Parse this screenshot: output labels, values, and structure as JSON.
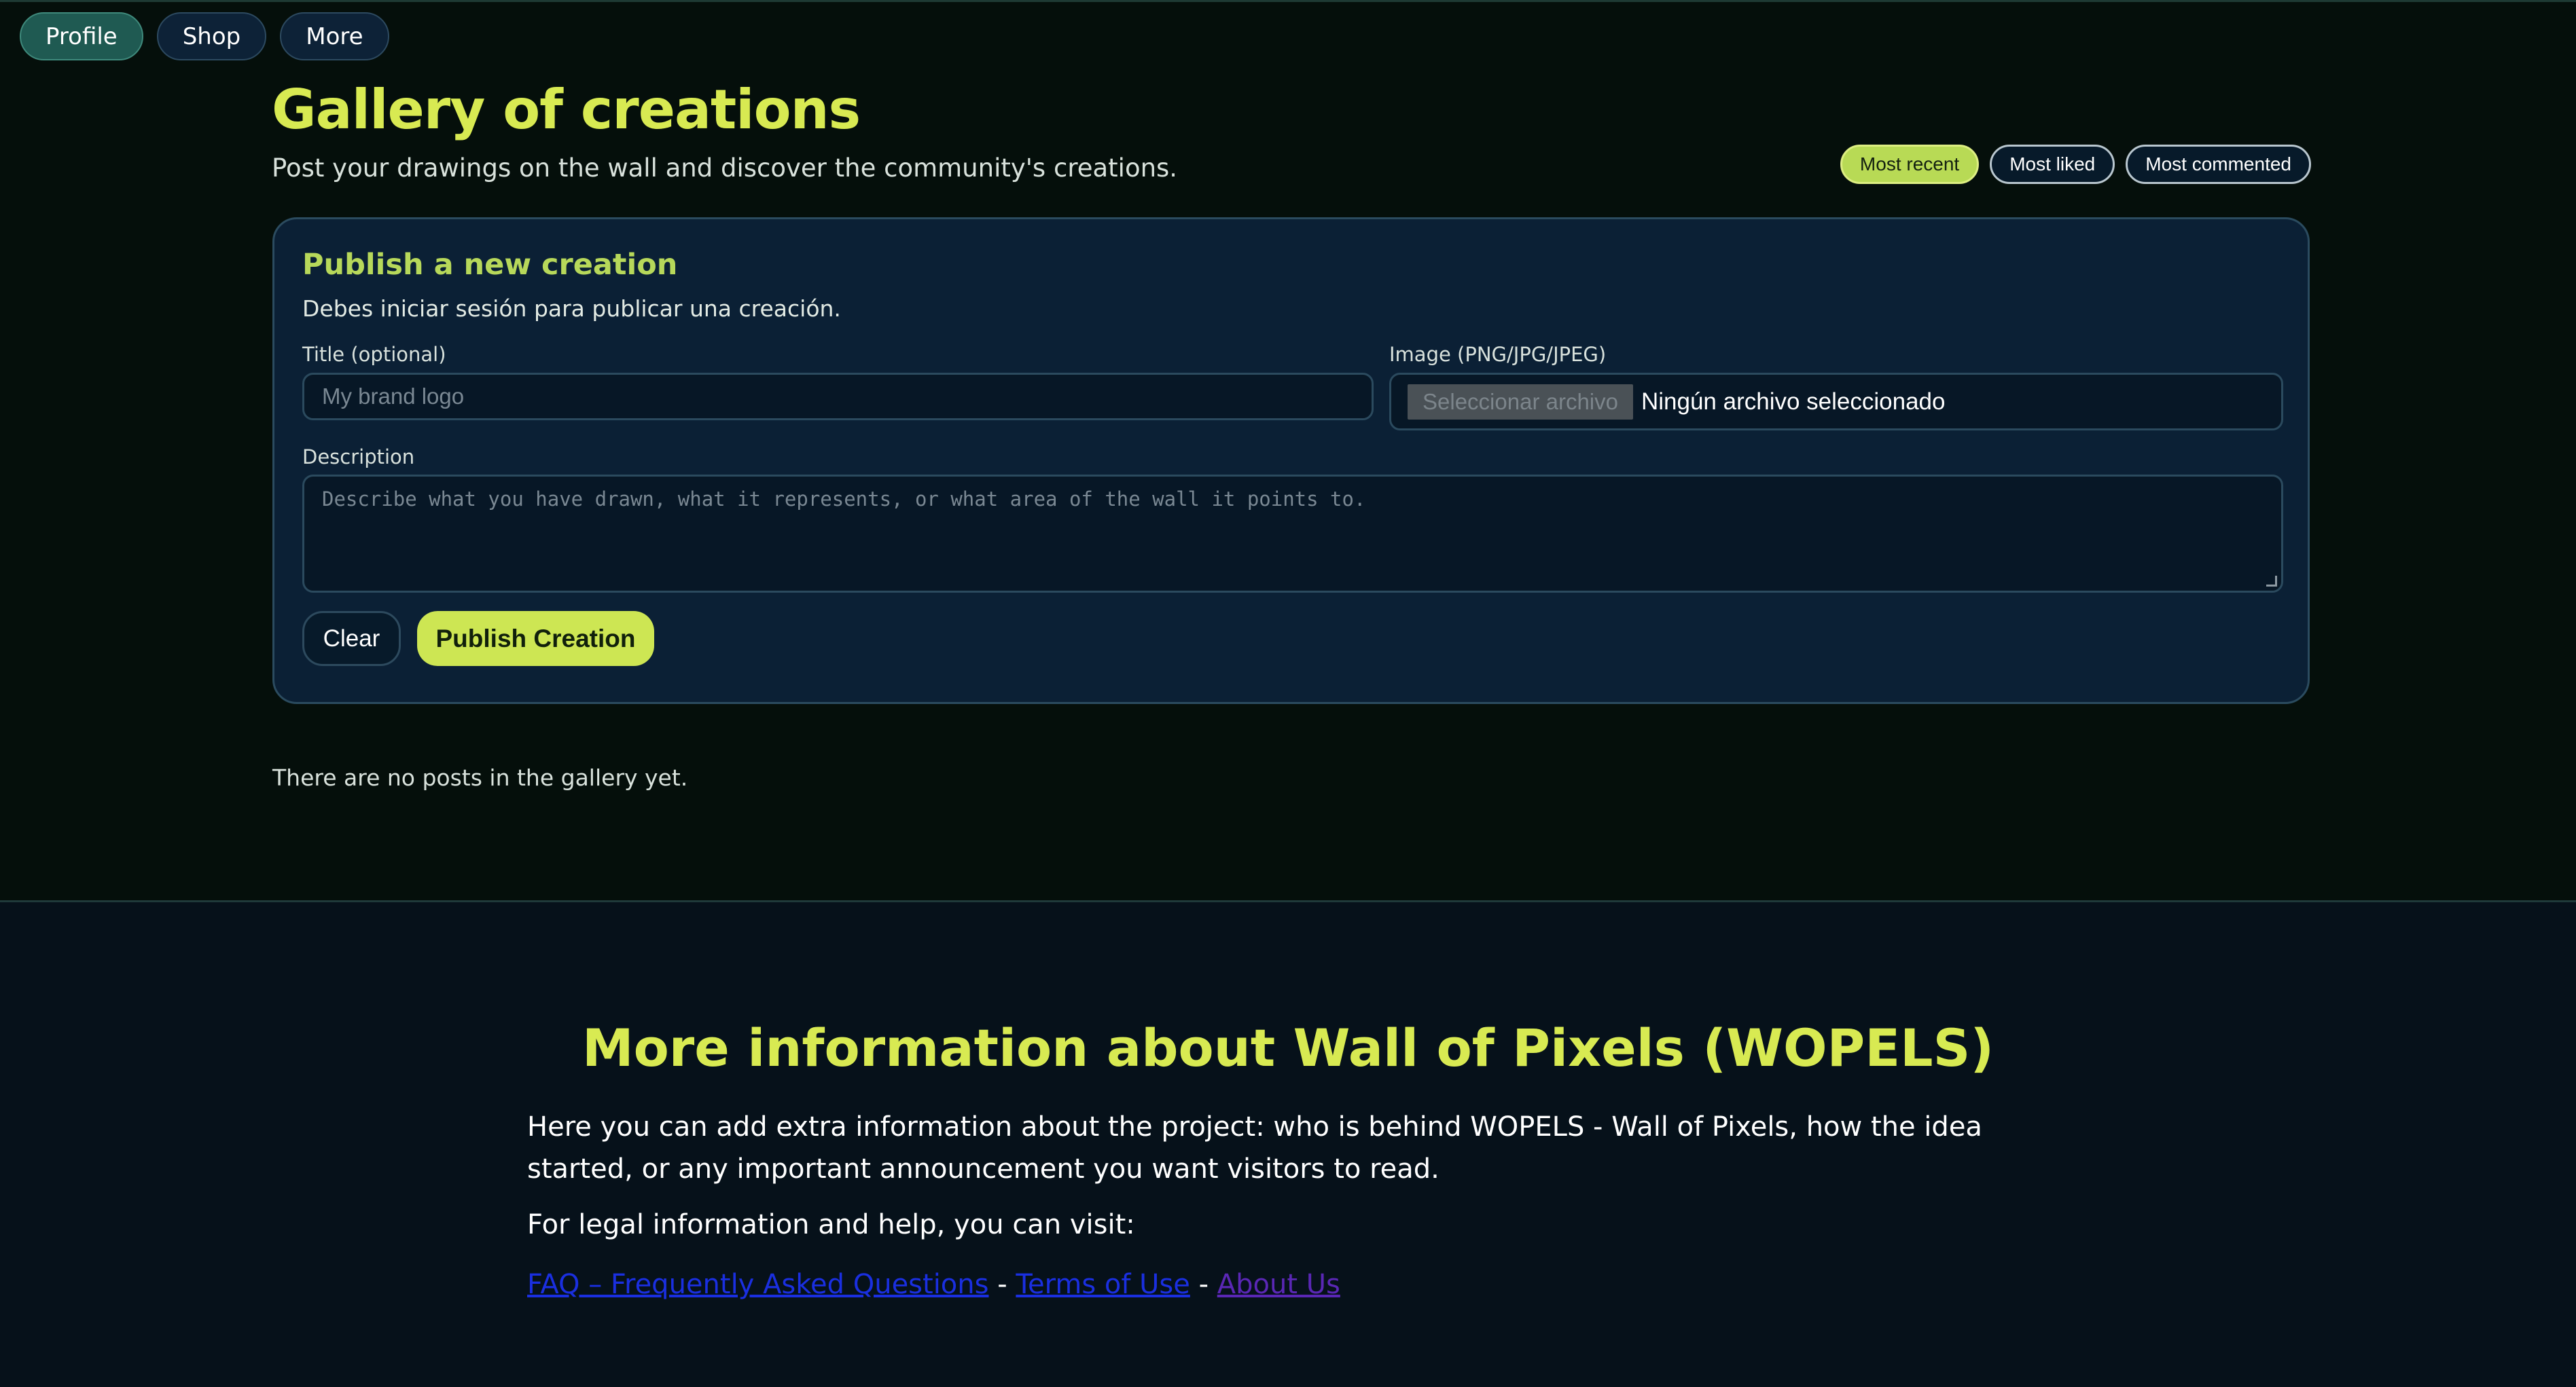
{
  "nav": {
    "items": [
      {
        "label": "Profile",
        "active": true
      },
      {
        "label": "Shop",
        "active": false
      },
      {
        "label": "More",
        "active": false
      }
    ]
  },
  "gallery": {
    "title": "Gallery of creations",
    "subtitle": "Post your drawings on the wall and discover the community's creations.",
    "sort_options": [
      {
        "label": "Most recent",
        "active": true
      },
      {
        "label": "Most liked",
        "active": false
      },
      {
        "label": "Most commented",
        "active": false
      }
    ],
    "empty_message": "There are no posts in the gallery yet."
  },
  "publish": {
    "title": "Publish a new creation",
    "login_note": "Debes iniciar sesión para publicar una creación.",
    "title_label": "Title (optional)",
    "title_placeholder": "My brand logo",
    "image_label": "Image (PNG/JPG/JPEG)",
    "file_button": "Seleccionar archivo",
    "file_status": "Ningún archivo seleccionado",
    "description_label": "Description",
    "description_placeholder": "Describe what you have drawn, what it represents, or what area of the wall it points to.",
    "clear_label": "Clear",
    "publish_label": "Publish Creation"
  },
  "footer": {
    "title": "More information about Wall of Pixels (WOPELS)",
    "text": "Here you can add extra information about the project: who is behind WOPELS - Wall of Pixels, how the idea started, or any important announcement you want visitors to read.",
    "legal_intro": "For legal information and help, you can visit:",
    "links": {
      "faq": "FAQ – Frequently Asked Questions",
      "terms": "Terms of Use",
      "about": "About Us",
      "separator": " - "
    }
  },
  "colors": {
    "accent": "#d8ea52",
    "background": "#050f0b",
    "card": "#0b2035"
  }
}
